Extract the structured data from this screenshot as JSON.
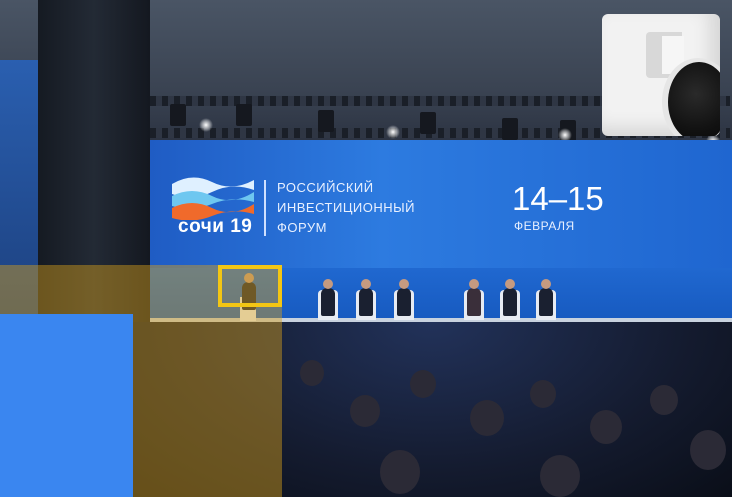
{
  "banner": {
    "brand_name": "сочи 19",
    "forum_lines": [
      "РОССИЙСКИЙ",
      "ИНВЕСТИЦИОННЫЙ",
      "ФОРУМ"
    ],
    "dates": "14–15",
    "month": "ФЕВРАЛЯ"
  },
  "colors": {
    "screen_blue": "#2470d8",
    "highlight_yellow": "#f3c614",
    "overlay_yellow": "#d6a01a",
    "overlay_blue": "#3a86f0",
    "device_white": "#f2f2f2"
  },
  "overlays": {
    "highlight_box": "yellow-outline",
    "yellow_patch": "semi-transparent",
    "blue_patch": "solid"
  },
  "inset_object": "white-wall-mounted-speaker"
}
